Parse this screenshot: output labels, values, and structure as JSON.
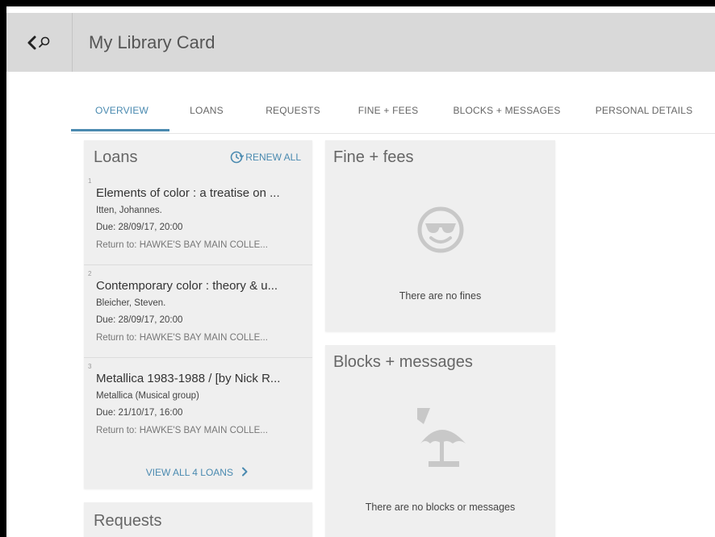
{
  "header": {
    "title": "My Library Card",
    "back_icon": "chevron-left-icon",
    "search_icon": "search-icon"
  },
  "tabs": [
    {
      "label": "OVERVIEW",
      "active": true
    },
    {
      "label": "LOANS",
      "active": false
    },
    {
      "label": "REQUESTS",
      "active": false
    },
    {
      "label": "FINE + FEES",
      "active": false
    },
    {
      "label": "BLOCKS + MESSAGES",
      "active": false
    },
    {
      "label": "PERSONAL DETAILS",
      "active": false
    }
  ],
  "loans": {
    "title": "Loans",
    "renew_all_label": "RENEW ALL",
    "items": [
      {
        "num": "1",
        "title": "Elements of color : a treatise on ...",
        "author": "Itten, Johannes.",
        "due": "Due: 28/09/17, 20:00",
        "return_to": "Return to: HAWKE'S BAY MAIN COLLE..."
      },
      {
        "num": "2",
        "title": "Contemporary color : theory & u...",
        "author": "Bleicher, Steven.",
        "due": "Due: 28/09/17, 20:00",
        "return_to": "Return to: HAWKE'S BAY MAIN COLLE..."
      },
      {
        "num": "3",
        "title": "Metallica 1983-1988 / [by Nick R...",
        "author": "Metallica (Musical group)",
        "due": "Due: 21/10/17, 16:00",
        "return_to": "Return to: HAWKE'S BAY MAIN COLLE..."
      }
    ],
    "view_all_label": "VIEW ALL 4 LOANS"
  },
  "fines": {
    "title": "Fine + fees",
    "empty_message": "There are no fines",
    "icon": "sunglasses-smiley-icon"
  },
  "blocks": {
    "title": "Blocks + messages",
    "empty_message": "There are no blocks or messages",
    "icon": "beach-umbrella-icon"
  },
  "requests": {
    "title": "Requests"
  },
  "colors": {
    "accent": "#4a8ab0",
    "header_bg": "#d9d9d9",
    "card_bg": "#efefef",
    "icon_gray": "#c8c8c8"
  }
}
